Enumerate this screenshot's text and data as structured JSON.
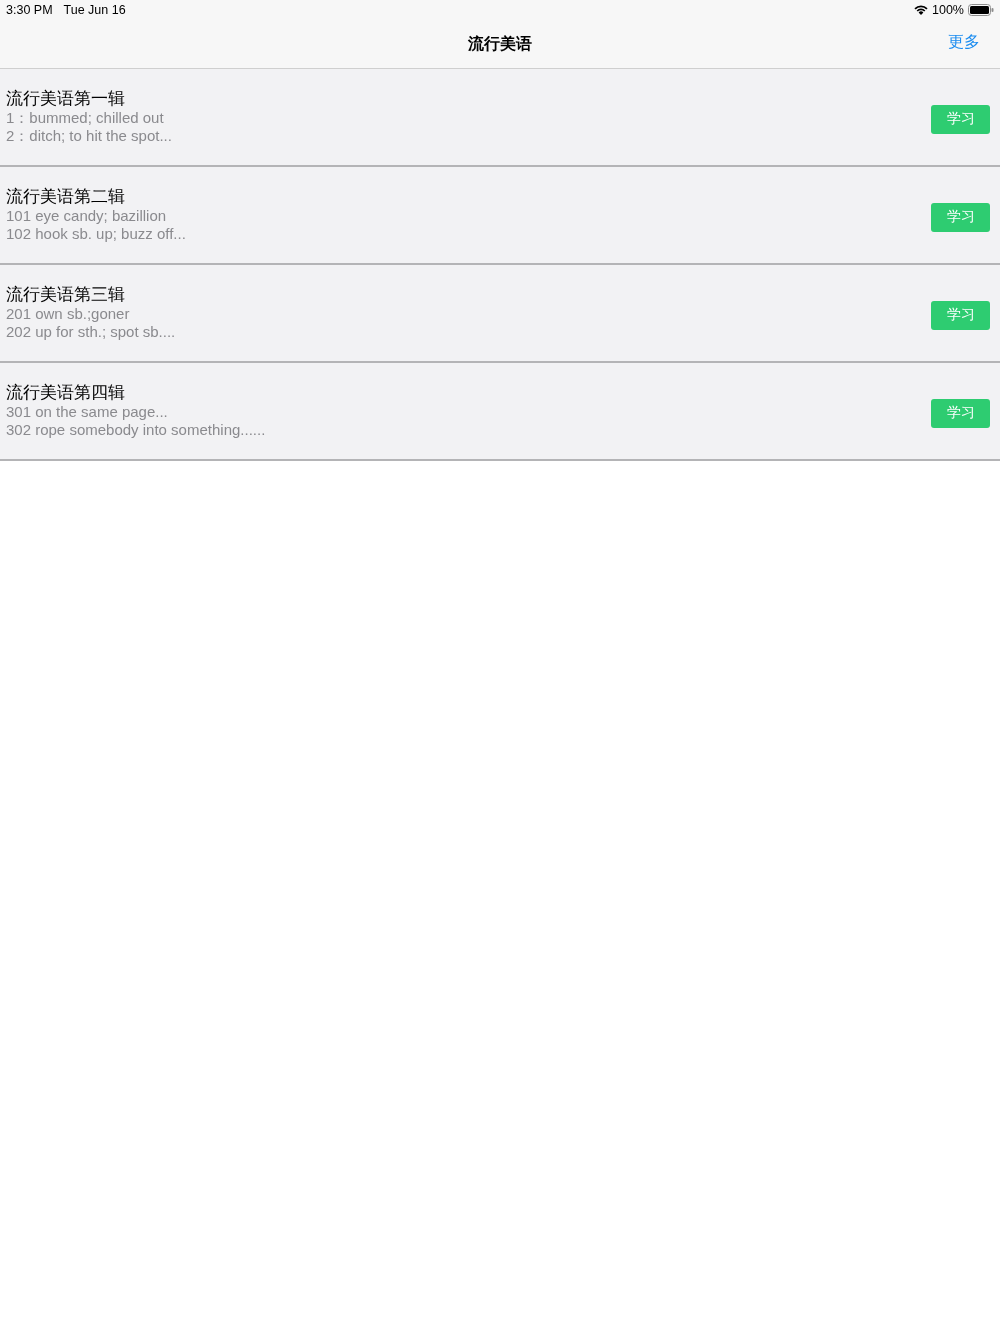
{
  "status_bar": {
    "time": "3:30 PM",
    "date": "Tue Jun 16",
    "battery": "100%"
  },
  "nav_bar": {
    "title": "流行美语",
    "action": "更多"
  },
  "albums": [
    {
      "title": "流行美语第一辑",
      "lines": [
        "1：bummed; chilled out",
        "2：ditch; to hit the spot..."
      ],
      "button": "学习"
    },
    {
      "title": "流行美语第二辑",
      "lines": [
        "101 eye candy; bazillion",
        "102 hook sb. up; buzz off..."
      ],
      "button": "学习"
    },
    {
      "title": "流行美语第三辑",
      "lines": [
        "201 own sb.;goner",
        "202 up for sth.; spot sb...."
      ],
      "button": "学习"
    },
    {
      "title": "流行美语第四辑",
      "lines": [
        "301 on the same page...",
        "302 rope somebody into something......"
      ],
      "button": "学习"
    }
  ]
}
